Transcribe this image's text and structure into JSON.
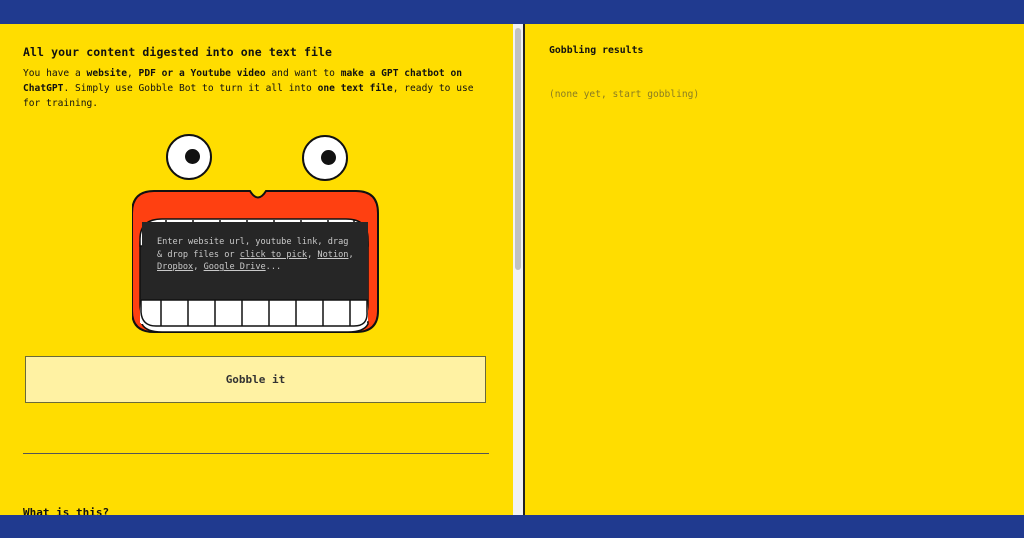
{
  "left": {
    "heading": "All your content digested into one text file",
    "intro": {
      "p1": "You have a ",
      "b1": "website",
      "p2": ", ",
      "b2": "PDF or a Youtube video",
      "p3": " and want to ",
      "b3": "make a GPT chatbot on ChatGPT",
      "p4": ". Simply use Gobble Bot to turn it all into ",
      "b4": "one text file",
      "p5": ", ready to use for training."
    },
    "input": {
      "line1": "Enter website url, youtube link, drag & drop files or ",
      "click_to_pick": "click to pick",
      "sep1": ", ",
      "notion": "Notion",
      "sep2": ", ",
      "dropbox": "Dropbox",
      "sep3": ", ",
      "google_drive": "Google Drive",
      "ellipsis": "..."
    },
    "gobble_button": "Gobble it",
    "faq_heading": "What is this?"
  },
  "right": {
    "title": "Gobbling results",
    "empty_state": "(none yet, start gobbling)"
  },
  "colors": {
    "background_yellow": "#ffdd00",
    "band_blue": "#203a8f",
    "mouth_red": "#ff4011",
    "button_fill": "#fff2a3",
    "input_dark": "#262626"
  },
  "icons": {
    "mascot": "gobble-monster-icon"
  }
}
